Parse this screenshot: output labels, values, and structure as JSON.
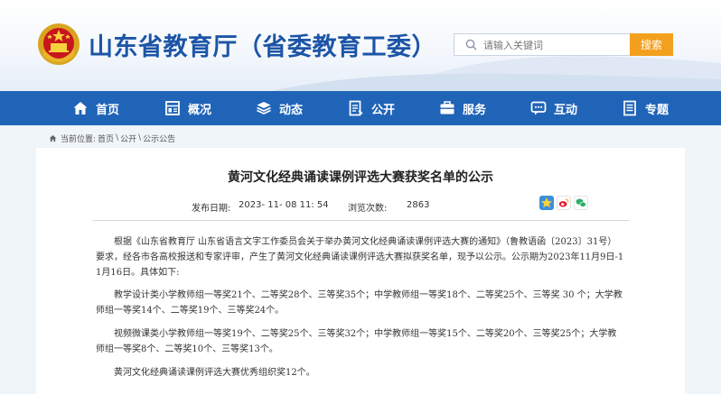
{
  "header": {
    "site_title": "山东省教育厅（省委教育工委）",
    "search_placeholder": "请输入关键词",
    "search_button": "搜索"
  },
  "nav": {
    "items": [
      {
        "label": "首页",
        "icon": "home-icon"
      },
      {
        "label": "概况",
        "icon": "overview-icon"
      },
      {
        "label": "动态",
        "icon": "news-icon"
      },
      {
        "label": "公开",
        "icon": "disclosure-icon"
      },
      {
        "label": "服务",
        "icon": "service-icon"
      },
      {
        "label": "互动",
        "icon": "interaction-icon"
      },
      {
        "label": "专题",
        "icon": "topic-icon"
      }
    ]
  },
  "breadcrumb": {
    "prefix": "当前位置:",
    "items": [
      "首页",
      "公开",
      "公示公告"
    ],
    "separator": "\\"
  },
  "article": {
    "title": "黄河文化经典诵读课例评选大赛获奖名单的公示",
    "publish_label": "发布日期:",
    "publish_date": "2023- 11- 08 11: 54",
    "views_label": "浏览次数:",
    "views": "2863",
    "paragraphs": [
      "根据《山东省教育厅 山东省语言文字工作委员会关于举办黄河文化经典诵读课例评选大赛的通知》（鲁教语函〔2023〕31号）要求，经各市各高校报送和专家评审，产生了黄河文化经典诵读课例评选大赛拟获奖名单，现予以公示。公示期为2023年11月9日-11月16日。具体如下:",
      "教学设计类小学教师组一等奖21个、二等奖28个、三等奖35个；中学教师组一等奖18个、二等奖25个、三等奖 30 个；大学教师组一等奖14个、二等奖19个、三等奖24个。",
      "视频微课类小学教师组一等奖19个、二等奖25个、三等奖32个；中学教师组一等奖15个、二等奖20个、三等奖25个；大学教师组一等奖8个、二等奖10个、三等奖13个。",
      "黄河文化经典诵读课例评选大赛优秀组织奖12个。"
    ]
  },
  "colors": {
    "brand_blue": "#2064b8",
    "title_blue": "#1c55a6",
    "search_orange": "#f3a01e"
  }
}
